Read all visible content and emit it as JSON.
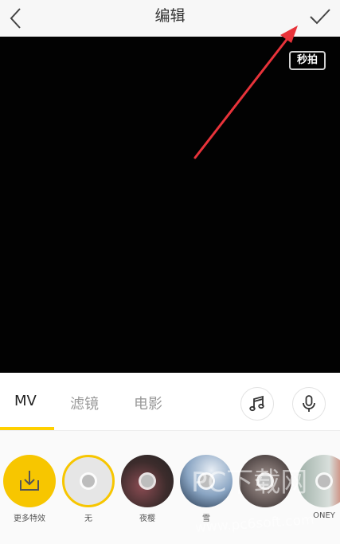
{
  "header": {
    "title": "编辑",
    "back_icon": "chevron-left-icon",
    "confirm_icon": "checkmark-icon"
  },
  "preview": {
    "badge": "秒拍"
  },
  "tabs": [
    {
      "label": "MV",
      "active": true
    },
    {
      "label": "滤镜",
      "active": false
    },
    {
      "label": "电影",
      "active": false
    }
  ],
  "tools": {
    "music_icon": "music-note-icon",
    "mic_icon": "microphone-icon"
  },
  "effects": [
    {
      "label": "更多特效",
      "icon": "download-icon",
      "color": "#f7c600"
    },
    {
      "label": "无",
      "color": "#e6e6e6"
    },
    {
      "label": "夜樱",
      "color": "#5a3a3a"
    },
    {
      "label": "雪",
      "color": "#8aa5c3"
    },
    {
      "label": "",
      "color": "#6e6260"
    },
    {
      "label": "ONEY",
      "color": "#b9c8c2"
    }
  ],
  "watermark": {
    "line1": "PC下载网",
    "line2": "www.pc6soft.com"
  },
  "colors": {
    "accent": "#ffd000",
    "annotation_arrow": "#e8333a"
  }
}
